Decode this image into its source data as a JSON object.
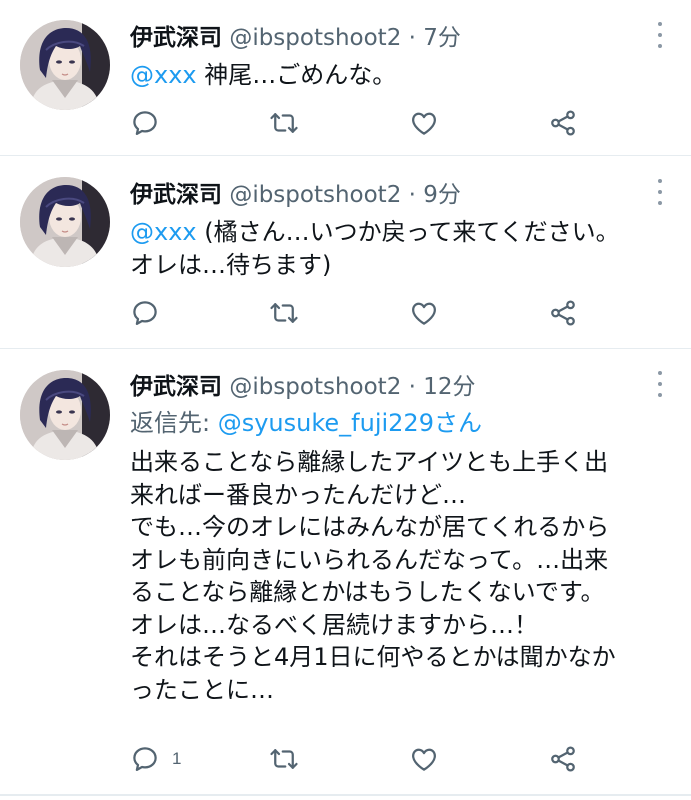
{
  "tweets": [
    {
      "name": "伊武深司",
      "handle": "@ibspotshoot2",
      "sep": "·",
      "time": "7分",
      "mention": "@xxx",
      "text": " 神尾…ごめんな。",
      "reply_count": ""
    },
    {
      "name": "伊武深司",
      "handle": "@ibspotshoot2",
      "sep": "·",
      "time": "9分",
      "mention": "@xxx",
      "text": " (橘さん…いつか戻って来てください。\nオレは…待ちます)",
      "reply_count": ""
    },
    {
      "name": "伊武深司",
      "handle": "@ibspotshoot2",
      "sep": "·",
      "time": "12分",
      "reply_prefix": "返信先: ",
      "reply_target": "@syusuke_fuji229さん",
      "text": "出来ることなら離縁したアイツとも上手く出\n来ればー番良かったんだけど…\nでも…今のオレにはみんなが居てくれるから\nオレも前向きにいられるんだなって。…出来\nることなら離縁とかはもうしたくないです。\nオレは…なるべく居続けますから…！\nそれはそうと4月1日に何やるとかは聞かなか\nったことに…",
      "reply_count": "1"
    }
  ],
  "icons": [
    "reply-icon",
    "retweet-icon",
    "like-icon",
    "share-icon",
    "more-icon",
    "avatar"
  ],
  "colors": {
    "mention": "#1d9bf0",
    "meta": "#536471",
    "icon": "#536471",
    "divider": "#e6ecf0"
  }
}
